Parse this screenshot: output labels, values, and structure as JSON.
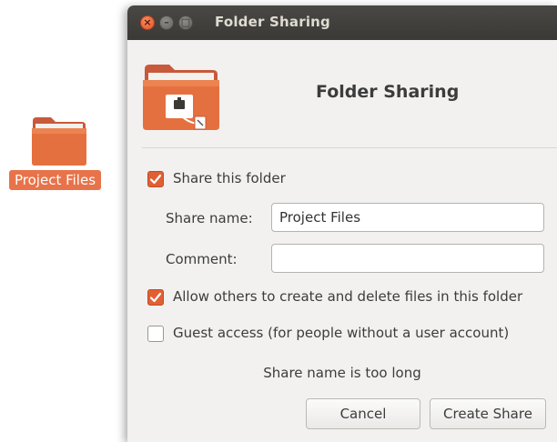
{
  "desktop": {
    "icon_label": "Project Files",
    "icon_name": "folder-icon",
    "accent": "#e8734a"
  },
  "window": {
    "title": "Folder Sharing",
    "close_glyph": "×",
    "min_glyph": "–",
    "max_glyph": "□"
  },
  "header": {
    "title": "Folder Sharing",
    "icon_name": "shared-folder-icon"
  },
  "options": {
    "share_folder": {
      "label": "Share this folder",
      "checked": true
    },
    "allow_others": {
      "label": "Allow others to create and delete files in this folder",
      "checked": true
    },
    "guest_access": {
      "label": "Guest access (for people without a user account)",
      "checked": false
    }
  },
  "fields": {
    "share_name": {
      "label": "Share name:",
      "value": "Project Files"
    },
    "comment": {
      "label": "Comment:",
      "value": ""
    }
  },
  "status": "Share name is too long",
  "buttons": {
    "cancel": "Cancel",
    "create": "Create Share"
  },
  "colors": {
    "checkbox_on": "#e05f34",
    "titlebar": "#3c3b37",
    "dialog_bg": "#f2f1f0"
  }
}
